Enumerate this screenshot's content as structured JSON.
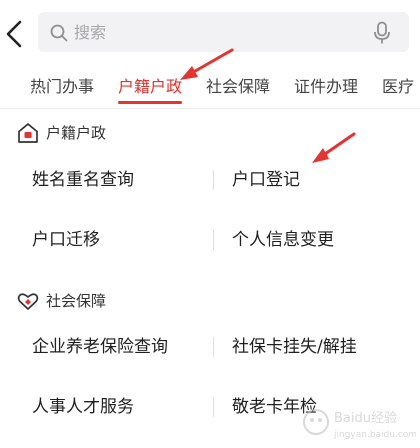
{
  "header": {
    "back_icon": "chevron-left-icon",
    "search": {
      "icon": "search-icon",
      "placeholder": "搜索",
      "mic_icon": "microphone-icon"
    }
  },
  "tabs": [
    {
      "label": "热门办事",
      "active": false
    },
    {
      "label": "户籍户政",
      "active": true
    },
    {
      "label": "社会保障",
      "active": false
    },
    {
      "label": "证件办理",
      "active": false
    },
    {
      "label": "医疗",
      "active": false
    }
  ],
  "sections": [
    {
      "title": "户籍户政",
      "icon": "house-icon",
      "items": [
        "姓名重名查询",
        "户口登记",
        "户口迁移",
        "个人信息变更"
      ]
    },
    {
      "title": "社会保障",
      "icon": "heart-hand-icon",
      "items": [
        "企业养老保险查询",
        "社保卡挂失/解挂",
        "人事人才服务",
        "敬老卡年检"
      ]
    }
  ],
  "colors": {
    "accent": "#e8322f",
    "text": "#1f1f1f",
    "search_bg": "#f2f2f4"
  },
  "watermark": {
    "site": "Baidu经验",
    "site_url_text": "jingyan.baidu.com"
  }
}
